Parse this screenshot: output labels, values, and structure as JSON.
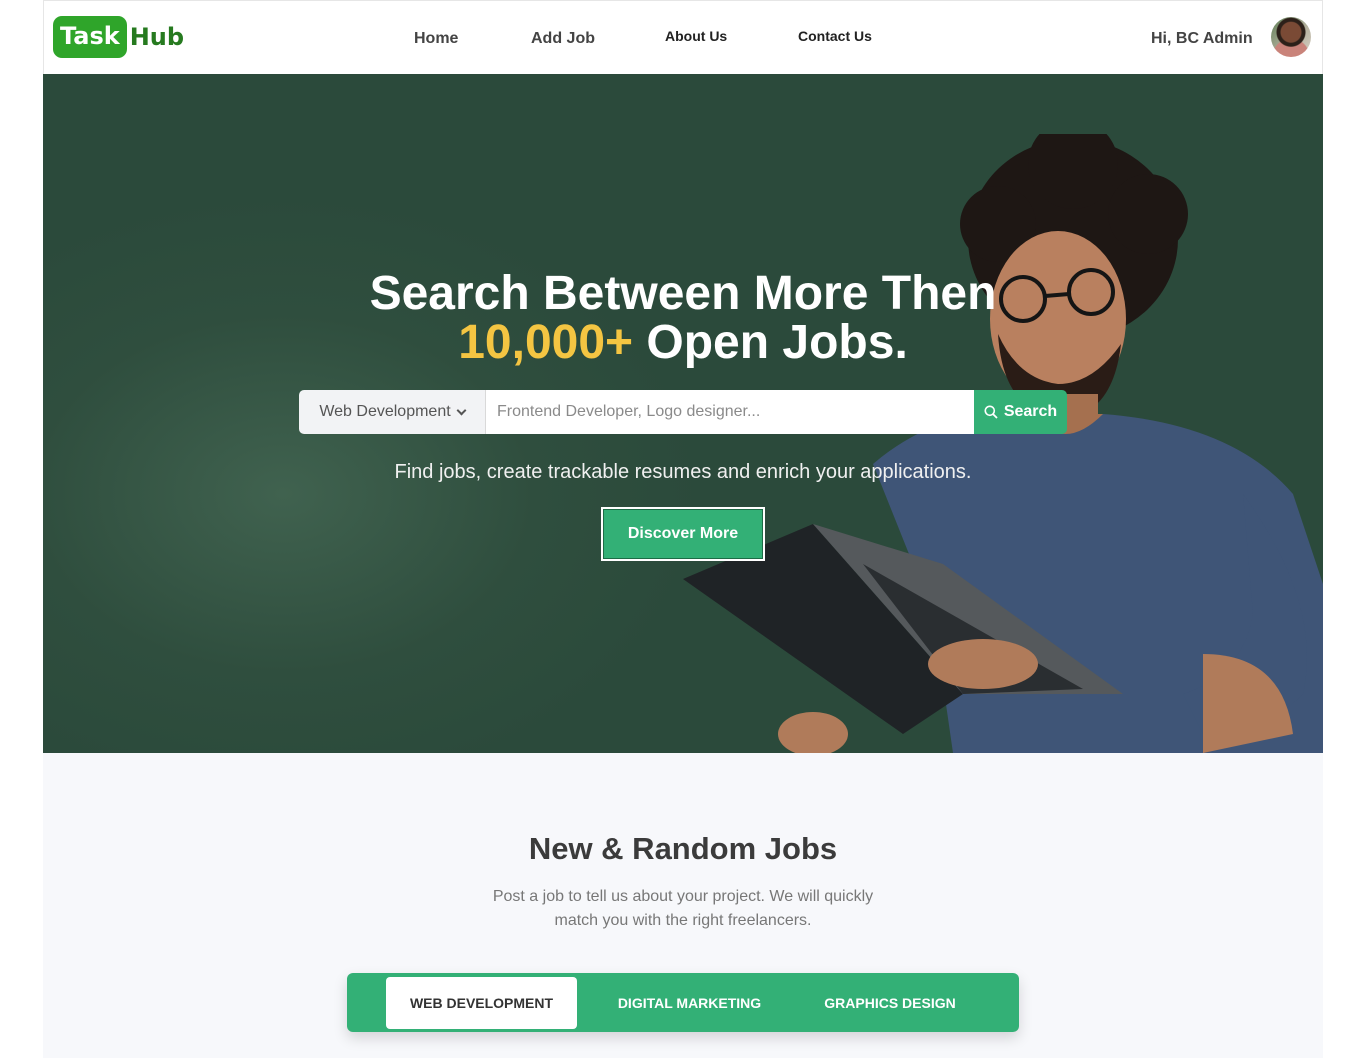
{
  "brand": {
    "part1": "Task",
    "part2": "Hub"
  },
  "nav": {
    "home": "Home",
    "add_job": "Add Job",
    "about": "About Us",
    "contact": "Contact Us"
  },
  "user": {
    "greeting": "Hi, BC Admin"
  },
  "hero": {
    "title_line1": "Search Between More Then",
    "title_highlight": "10,000+",
    "title_line2_rest": " Open Jobs.",
    "category_select": "Web Development",
    "search_placeholder": "Frontend Developer, Logo designer...",
    "search_button": "Search",
    "subtitle": "Find jobs, create trackable resumes and enrich your applications.",
    "cta": "Discover More"
  },
  "jobs_section": {
    "title": "New & Random Jobs",
    "description": "Post a job to tell us about your project. We will quickly match you with the right freelancers.",
    "tabs": [
      "WEB DEVELOPMENT",
      "DIGITAL MARKETING",
      "GRAPHICS DESIGN"
    ]
  },
  "colors": {
    "accent_green": "#33b076",
    "hero_bg": "#2b4a3b",
    "highlight_yellow": "#f4c542",
    "logo_green": "#2fa52a"
  }
}
